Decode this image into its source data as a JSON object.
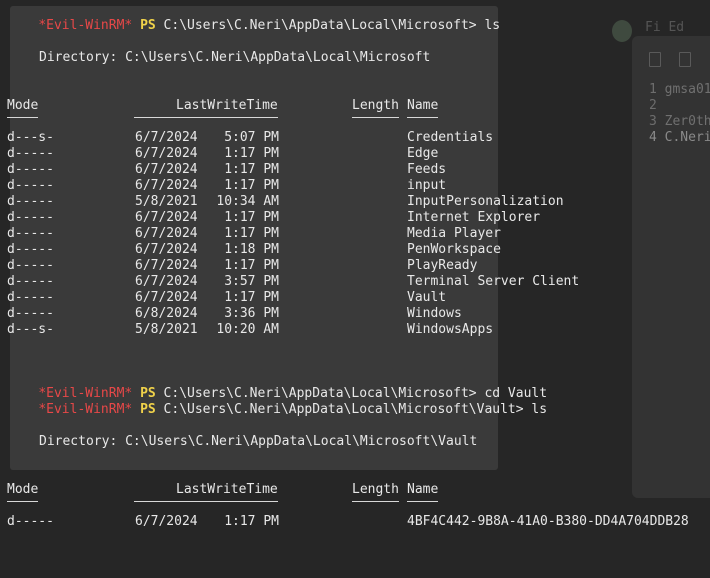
{
  "prompt": {
    "evil": "*Evil-WinRM*",
    "ps": "PS"
  },
  "session": [
    {
      "kind": "cmd",
      "path": "C:\\Users\\C.Neri\\AppData\\Local\\Microsoft>",
      "command": "ls"
    },
    {
      "kind": "dir",
      "text": "Directory: C:\\Users\\C.Neri\\AppData\\Local\\Microsoft"
    }
  ],
  "listing1": {
    "headers": {
      "mode": "Mode",
      "lastwrite": "LastWriteTime",
      "length": "Length",
      "name": "Name"
    },
    "rows": [
      {
        "mode": "d---s-",
        "date": "6/7/2024",
        "time": "5:07 PM",
        "name": "Credentials"
      },
      {
        "mode": "d-----",
        "date": "6/7/2024",
        "time": "1:17 PM",
        "name": "Edge"
      },
      {
        "mode": "d-----",
        "date": "6/7/2024",
        "time": "1:17 PM",
        "name": "Feeds"
      },
      {
        "mode": "d-----",
        "date": "6/7/2024",
        "time": "1:17 PM",
        "name": "input"
      },
      {
        "mode": "d-----",
        "date": "5/8/2021",
        "time": "10:34 AM",
        "name": "InputPersonalization"
      },
      {
        "mode": "d-----",
        "date": "6/7/2024",
        "time": "1:17 PM",
        "name": "Internet Explorer"
      },
      {
        "mode": "d-----",
        "date": "6/7/2024",
        "time": "1:17 PM",
        "name": "Media Player"
      },
      {
        "mode": "d-----",
        "date": "6/7/2024",
        "time": "1:18 PM",
        "name": "PenWorkspace"
      },
      {
        "mode": "d-----",
        "date": "6/7/2024",
        "time": "1:17 PM",
        "name": "PlayReady"
      },
      {
        "mode": "d-----",
        "date": "6/7/2024",
        "time": "3:57 PM",
        "name": "Terminal Server Client"
      },
      {
        "mode": "d-----",
        "date": "6/7/2024",
        "time": "1:17 PM",
        "name": "Vault"
      },
      {
        "mode": "d-----",
        "date": "6/8/2024",
        "time": "3:36 PM",
        "name": "Windows"
      },
      {
        "mode": "d---s-",
        "date": "5/8/2021",
        "time": "10:20 AM",
        "name": "WindowsApps"
      }
    ]
  },
  "cmd2": {
    "path": "C:\\Users\\C.Neri\\AppData\\Local\\Microsoft>",
    "command": "cd Vault"
  },
  "cmd3": {
    "path": "C:\\Users\\C.Neri\\AppData\\Local\\Microsoft\\Vault>",
    "command": "ls"
  },
  "dir2": "Directory: C:\\Users\\C.Neri\\AppData\\Local\\Microsoft\\Vault",
  "listing2": {
    "headers": {
      "mode": "Mode",
      "lastwrite": "LastWriteTime",
      "length": "Length",
      "name": "Name"
    },
    "rows": [
      {
        "mode": "d-----",
        "date": "6/7/2024",
        "time": "1:17 PM",
        "name": "4BF4C442-9B8A-41A0-B380-DD4A704DDB28"
      }
    ]
  },
  "background_panel": {
    "numbers": [
      "1",
      "2",
      "3",
      "4"
    ],
    "fragments": [
      "gmsa01",
      "Zer0th",
      "C.Neri"
    ],
    "top_text": "Fi  Ed"
  },
  "colors": {
    "prompt_red": "#e74848",
    "ps_yellow": "#f0d24a",
    "text": "#e8e8e8",
    "background": "#262626"
  }
}
